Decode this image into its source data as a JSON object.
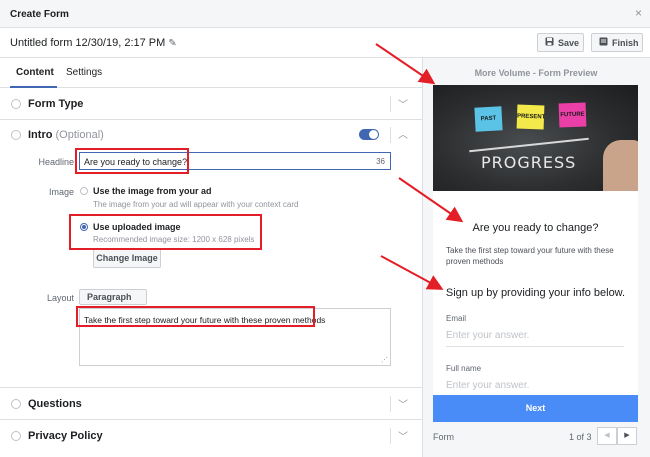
{
  "dialog": {
    "title": "Create Form",
    "close_glyph": "×"
  },
  "formbar": {
    "name": "Untitled form 12/30/19, 2:17 PM",
    "save_label": "Save",
    "finish_label": "Finish"
  },
  "tabs": {
    "content": "Content",
    "settings": "Settings"
  },
  "sections": {
    "form_type": "Form Type",
    "intro": "Intro",
    "intro_optional": "(Optional)",
    "questions": "Questions",
    "privacy": "Privacy Policy"
  },
  "intro": {
    "headline_label": "Headline",
    "headline_value": "Are you ready to change?",
    "headline_count": "36",
    "image_label": "Image",
    "option_ad_title": "Use the image from your ad",
    "option_ad_sub": "The image from your ad will appear with your context card",
    "option_upload_title": "Use uploaded image",
    "option_upload_sub": "Recommended image size: 1200 x 628 pixels",
    "change_image_label": "Change Image",
    "layout_label": "Layout",
    "layout_value": "Paragraph",
    "description_value": "Take the first step toward your future with these proven methods"
  },
  "preview": {
    "title": "More Volume - Form Preview",
    "image_notes": [
      "PAST",
      "PRESENT",
      "FUTURE"
    ],
    "image_word": "PROGRESS",
    "headline": "Are you ready to change?",
    "description": "Take the first step toward your future with these proven methods",
    "signup": "Sign up by providing your info below.",
    "fields": [
      {
        "label": "Email",
        "placeholder": "Enter your answer."
      },
      {
        "label": "Full name",
        "placeholder": "Enter your answer."
      }
    ],
    "next_label": "Next",
    "footer_label": "Form",
    "page_indicator": "1 of 3"
  },
  "colors": {
    "accent": "#4267b2",
    "next_button": "#4a8cf7",
    "annotation_red": "#e41e26",
    "note_blue": "#5bc4e6",
    "note_yellow": "#f4e94a",
    "note_pink": "#e93fa6"
  }
}
